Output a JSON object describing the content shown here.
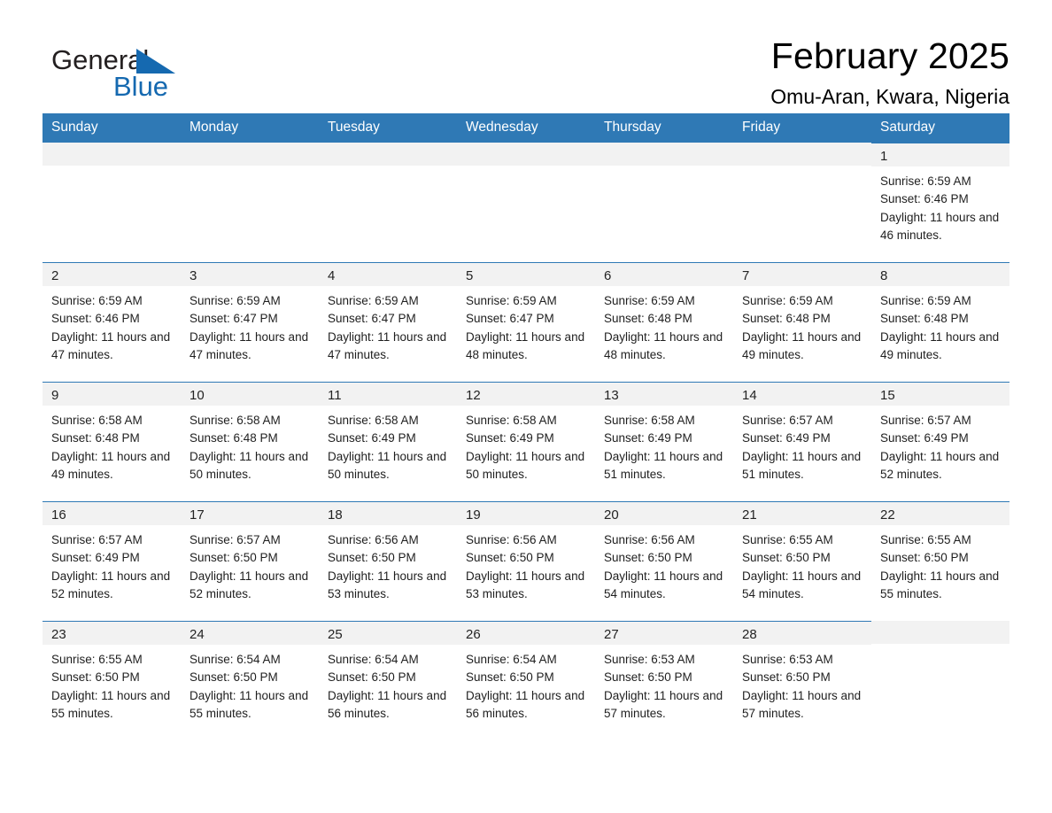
{
  "brand": {
    "word_one": "General",
    "word_two": "Blue",
    "accent_color": "#1569b0",
    "triangle_icon": "brand-triangle-icon"
  },
  "header": {
    "title": "February 2025",
    "subtitle": "Omu-Aran, Kwara, Nigeria"
  },
  "calendar": {
    "header_bg": "#2f79b5",
    "daynum_bg": "#f2f2f2",
    "weekdays": [
      "Sunday",
      "Monday",
      "Tuesday",
      "Wednesday",
      "Thursday",
      "Friday",
      "Saturday"
    ],
    "weeks": [
      [
        {
          "day": "",
          "empty": true
        },
        {
          "day": "",
          "empty": true
        },
        {
          "day": "",
          "empty": true
        },
        {
          "day": "",
          "empty": true
        },
        {
          "day": "",
          "empty": true
        },
        {
          "day": "",
          "empty": true
        },
        {
          "day": "1",
          "sunrise": "Sunrise: 6:59 AM",
          "sunset": "Sunset: 6:46 PM",
          "daylight": "Daylight: 11 hours and 46 minutes."
        }
      ],
      [
        {
          "day": "2",
          "sunrise": "Sunrise: 6:59 AM",
          "sunset": "Sunset: 6:46 PM",
          "daylight": "Daylight: 11 hours and 47 minutes."
        },
        {
          "day": "3",
          "sunrise": "Sunrise: 6:59 AM",
          "sunset": "Sunset: 6:47 PM",
          "daylight": "Daylight: 11 hours and 47 minutes."
        },
        {
          "day": "4",
          "sunrise": "Sunrise: 6:59 AM",
          "sunset": "Sunset: 6:47 PM",
          "daylight": "Daylight: 11 hours and 47 minutes."
        },
        {
          "day": "5",
          "sunrise": "Sunrise: 6:59 AM",
          "sunset": "Sunset: 6:47 PM",
          "daylight": "Daylight: 11 hours and 48 minutes."
        },
        {
          "day": "6",
          "sunrise": "Sunrise: 6:59 AM",
          "sunset": "Sunset: 6:48 PM",
          "daylight": "Daylight: 11 hours and 48 minutes."
        },
        {
          "day": "7",
          "sunrise": "Sunrise: 6:59 AM",
          "sunset": "Sunset: 6:48 PM",
          "daylight": "Daylight: 11 hours and 49 minutes."
        },
        {
          "day": "8",
          "sunrise": "Sunrise: 6:59 AM",
          "sunset": "Sunset: 6:48 PM",
          "daylight": "Daylight: 11 hours and 49 minutes."
        }
      ],
      [
        {
          "day": "9",
          "sunrise": "Sunrise: 6:58 AM",
          "sunset": "Sunset: 6:48 PM",
          "daylight": "Daylight: 11 hours and 49 minutes."
        },
        {
          "day": "10",
          "sunrise": "Sunrise: 6:58 AM",
          "sunset": "Sunset: 6:48 PM",
          "daylight": "Daylight: 11 hours and 50 minutes."
        },
        {
          "day": "11",
          "sunrise": "Sunrise: 6:58 AM",
          "sunset": "Sunset: 6:49 PM",
          "daylight": "Daylight: 11 hours and 50 minutes."
        },
        {
          "day": "12",
          "sunrise": "Sunrise: 6:58 AM",
          "sunset": "Sunset: 6:49 PM",
          "daylight": "Daylight: 11 hours and 50 minutes."
        },
        {
          "day": "13",
          "sunrise": "Sunrise: 6:58 AM",
          "sunset": "Sunset: 6:49 PM",
          "daylight": "Daylight: 11 hours and 51 minutes."
        },
        {
          "day": "14",
          "sunrise": "Sunrise: 6:57 AM",
          "sunset": "Sunset: 6:49 PM",
          "daylight": "Daylight: 11 hours and 51 minutes."
        },
        {
          "day": "15",
          "sunrise": "Sunrise: 6:57 AM",
          "sunset": "Sunset: 6:49 PM",
          "daylight": "Daylight: 11 hours and 52 minutes."
        }
      ],
      [
        {
          "day": "16",
          "sunrise": "Sunrise: 6:57 AM",
          "sunset": "Sunset: 6:49 PM",
          "daylight": "Daylight: 11 hours and 52 minutes."
        },
        {
          "day": "17",
          "sunrise": "Sunrise: 6:57 AM",
          "sunset": "Sunset: 6:50 PM",
          "daylight": "Daylight: 11 hours and 52 minutes."
        },
        {
          "day": "18",
          "sunrise": "Sunrise: 6:56 AM",
          "sunset": "Sunset: 6:50 PM",
          "daylight": "Daylight: 11 hours and 53 minutes."
        },
        {
          "day": "19",
          "sunrise": "Sunrise: 6:56 AM",
          "sunset": "Sunset: 6:50 PM",
          "daylight": "Daylight: 11 hours and 53 minutes."
        },
        {
          "day": "20",
          "sunrise": "Sunrise: 6:56 AM",
          "sunset": "Sunset: 6:50 PM",
          "daylight": "Daylight: 11 hours and 54 minutes."
        },
        {
          "day": "21",
          "sunrise": "Sunrise: 6:55 AM",
          "sunset": "Sunset: 6:50 PM",
          "daylight": "Daylight: 11 hours and 54 minutes."
        },
        {
          "day": "22",
          "sunrise": "Sunrise: 6:55 AM",
          "sunset": "Sunset: 6:50 PM",
          "daylight": "Daylight: 11 hours and 55 minutes."
        }
      ],
      [
        {
          "day": "23",
          "sunrise": "Sunrise: 6:55 AM",
          "sunset": "Sunset: 6:50 PM",
          "daylight": "Daylight: 11 hours and 55 minutes."
        },
        {
          "day": "24",
          "sunrise": "Sunrise: 6:54 AM",
          "sunset": "Sunset: 6:50 PM",
          "daylight": "Daylight: 11 hours and 55 minutes."
        },
        {
          "day": "25",
          "sunrise": "Sunrise: 6:54 AM",
          "sunset": "Sunset: 6:50 PM",
          "daylight": "Daylight: 11 hours and 56 minutes."
        },
        {
          "day": "26",
          "sunrise": "Sunrise: 6:54 AM",
          "sunset": "Sunset: 6:50 PM",
          "daylight": "Daylight: 11 hours and 56 minutes."
        },
        {
          "day": "27",
          "sunrise": "Sunrise: 6:53 AM",
          "sunset": "Sunset: 6:50 PM",
          "daylight": "Daylight: 11 hours and 57 minutes."
        },
        {
          "day": "28",
          "sunrise": "Sunrise: 6:53 AM",
          "sunset": "Sunset: 6:50 PM",
          "daylight": "Daylight: 11 hours and 57 minutes."
        },
        {
          "day": "",
          "empty": true
        }
      ]
    ]
  }
}
